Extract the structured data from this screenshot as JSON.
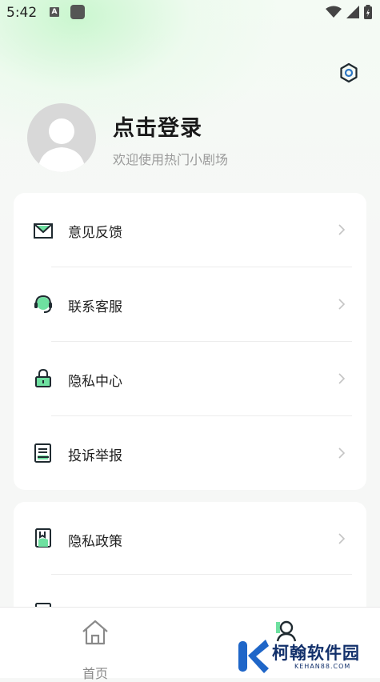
{
  "status_bar": {
    "time": "5:42",
    "notif_letter": "A"
  },
  "header": {
    "login_title": "点击登录",
    "login_subtitle": "欢迎使用热门小剧场"
  },
  "menu_group1": [
    {
      "label": "意见反馈",
      "icon": "mail-icon"
    },
    {
      "label": "联系客服",
      "icon": "headset-icon"
    },
    {
      "label": "隐私中心",
      "icon": "lock-icon"
    },
    {
      "label": "投诉举报",
      "icon": "report-icon"
    }
  ],
  "menu_group2": [
    {
      "label": "隐私政策",
      "icon": "policy-book-icon"
    }
  ],
  "tabbar": {
    "home_label": "首页"
  },
  "watermark": {
    "title": "柯翰软件园",
    "subtitle": "KEHAN88.COM"
  },
  "colors": {
    "accent": "#6ee0a0",
    "icon_stroke": "#1f2a30",
    "settings": "#2f78c4"
  }
}
